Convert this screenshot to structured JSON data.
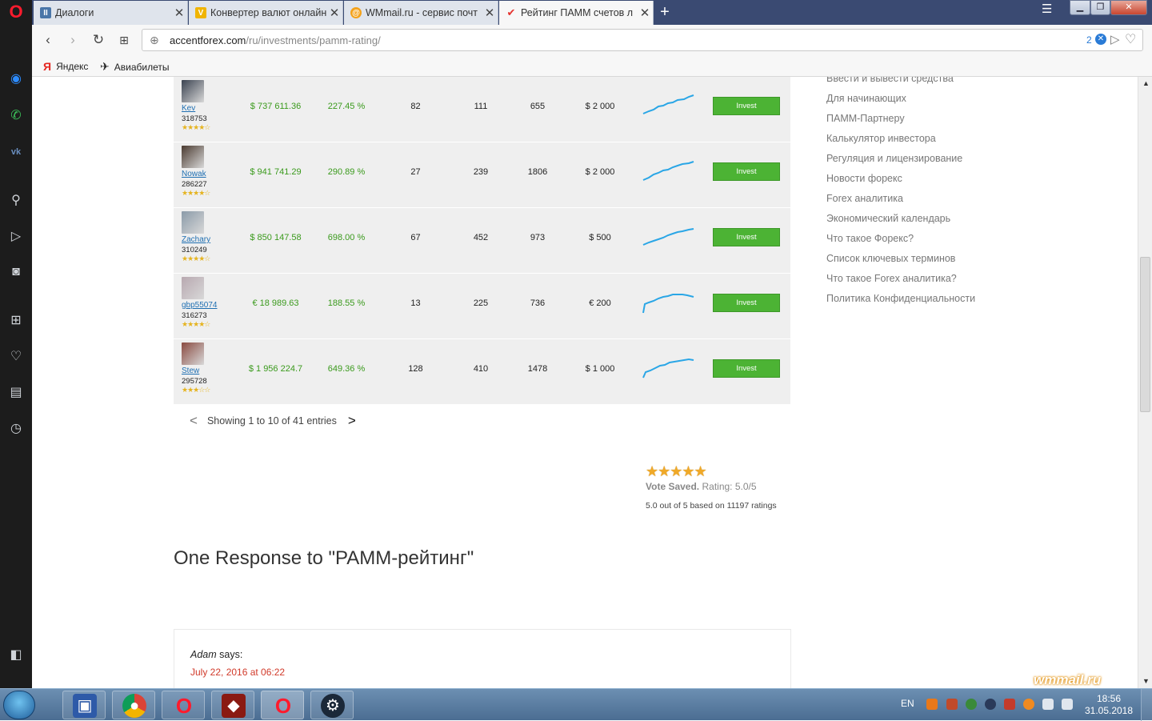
{
  "tabs": [
    {
      "label": "Диалоги",
      "favicon_color": "#4a76a8"
    },
    {
      "label": "Конвертер валют онлайн",
      "favicon_color": "#f0b400"
    },
    {
      "label": "WMmail.ru - сервис почт",
      "favicon_color": "#f4a21b"
    },
    {
      "label": "Рейтинг ПАММ счетов л",
      "favicon_color": "#e5322d"
    }
  ],
  "address": {
    "domain": "accentforex.com",
    "path": "/ru/investments/pamm-rating/",
    "ad_count": "2"
  },
  "bookmarks": [
    {
      "icon": "Я",
      "label": "Яндекс"
    },
    {
      "icon": "✈",
      "label": "Авиабилеты"
    }
  ],
  "pamm_rows": [
    {
      "name": "Kev",
      "id": "318753",
      "stars": "★★★★☆",
      "equity": "$ 737 611.36",
      "profit": "227.45 %",
      "col3": "82",
      "col4": "111",
      "col5": "655",
      "min": "$ 2 000",
      "avatar_color": "#3a4250"
    },
    {
      "name": "Nowak",
      "id": "286227",
      "stars": "★★★★☆",
      "equity": "$ 941 741.29",
      "profit": "290.89 %",
      "col3": "27",
      "col4": "239",
      "col5": "1806",
      "min": "$ 2 000",
      "avatar_color": "#4a3a30"
    },
    {
      "name": "Zachary",
      "id": "310249",
      "stars": "★★★★☆",
      "equity": "$ 850 147.58",
      "profit": "698.00 %",
      "col3": "67",
      "col4": "452",
      "col5": "973",
      "min": "$ 500",
      "avatar_color": "#8a9aa8"
    },
    {
      "name": "gbp55074",
      "id": "316273",
      "stars": "★★★★☆",
      "equity": "€ 18 989.63",
      "profit": "188.55 %",
      "col3": "13",
      "col4": "225",
      "col5": "736",
      "min": "€ 200",
      "avatar_color": "#b8a8b0"
    },
    {
      "name": "Stew",
      "id": "295728",
      "stars": "★★★☆☆",
      "equity": "$ 1 956 224.7",
      "profit": "649.36 %",
      "col3": "128",
      "col4": "410",
      "col5": "1478",
      "min": "$ 1 000",
      "avatar_color": "#8a4a40"
    }
  ],
  "invest_label": "Invest",
  "pager": {
    "prev": "<",
    "text": "Showing 1 to 10 of 41 entries",
    "next": ">"
  },
  "rating": {
    "stars": "★★★★★",
    "saved": "Vote Saved.",
    "rating_text": "Rating: 5.0/5",
    "based": "5.0 out of 5 based on 11197 ratings"
  },
  "response_title": "One Response to \"PAMM-рейтинг\"",
  "comment": {
    "author": "Adam",
    "says": "says:",
    "date": "July 22, 2016 at 06:22"
  },
  "menu": [
    "Ввести и вывести средства",
    "Для начинающих",
    "ПАММ-Партнеру",
    "Калькулятор инвестора",
    "Регуляция и лицензирование",
    "Новости форекс",
    "Forex аналитика",
    "Экономический календарь",
    "Что такое Форекс?",
    "Список ключевых терминов",
    "Что такое Forex аналитика?",
    "Политика Конфиденциальности"
  ],
  "taskbar": {
    "lang": "EN",
    "time": "18:56",
    "date": "31.05.2018"
  },
  "watermark": "wmmail.ru"
}
